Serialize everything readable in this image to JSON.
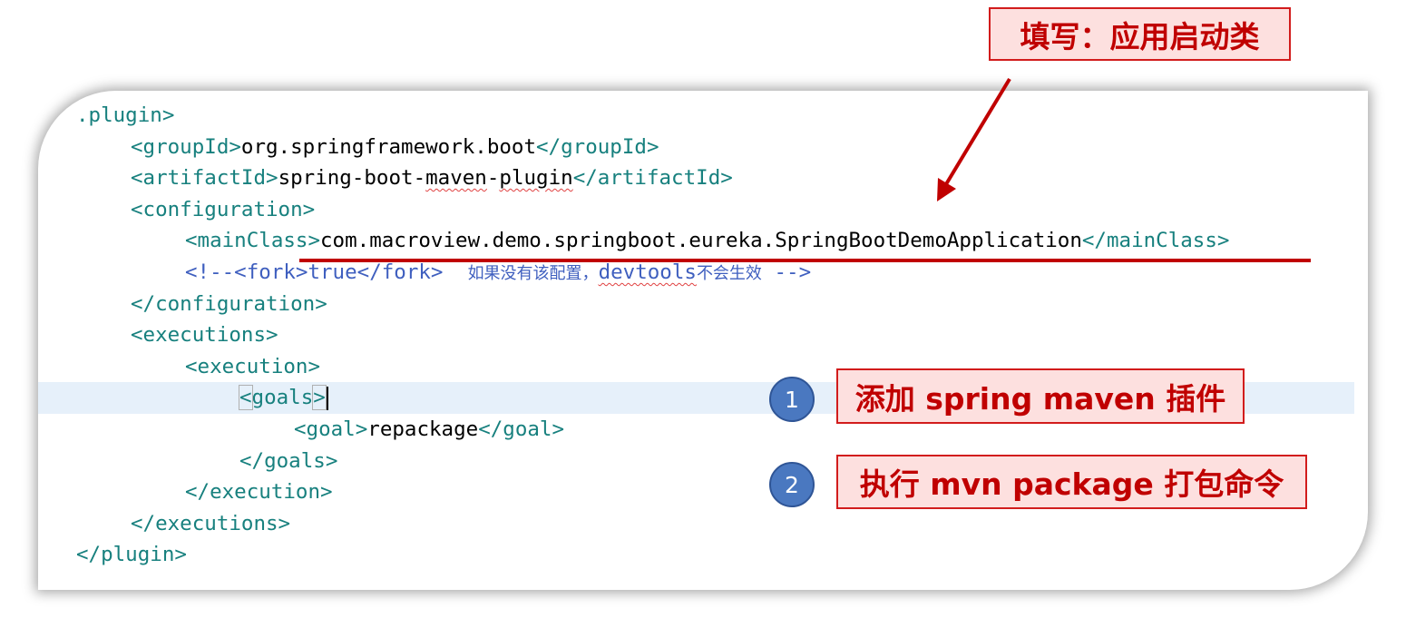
{
  "callouts": {
    "main_class_note": "填写：应用启动类",
    "step1_label": "添加 spring maven 插件",
    "step2_label": "执行 mvn package 打包命令",
    "step1_number": "1",
    "step2_number": "2"
  },
  "code": {
    "l1_tag": ".plugin>",
    "l2_open": "<groupId>",
    "l2_text": "org.springframework.boot",
    "l2_close": "</groupId>",
    "l3_open": "<artifactId>",
    "l3_t1": "spring-boot-",
    "l3_t2": "maven",
    "l3_t3": "-",
    "l3_t4": "plugin",
    "l3_close": "</artifactId>",
    "l4_open": "<configuration>",
    "l5_open": "<mainClass>",
    "l5_text": "com.macroview.demo.springboot.eureka.SpringBootDemoApplication",
    "l5_close": "</mainClass>",
    "l6_c1": "<!--<fork>true</fork>  ",
    "l6_cn1": "如果没有该配置，",
    "l6_c2": "devtools",
    "l6_cn2": "不会生效",
    "l6_c3": " -->",
    "l7_close": "</configuration>",
    "l8_open": "<executions>",
    "l9_open": "<execution>",
    "l10_lt": "<",
    "l10_tag": "goals",
    "l10_gt": ">",
    "l11_open": "<goal>",
    "l11_text": "repackage",
    "l11_close": "</goal>",
    "l12_close": "</goals>",
    "l13_close": "</execution>",
    "l14_close": "</executions>",
    "l15_close": "</plugin>"
  },
  "colors": {
    "tag": "#17807e",
    "comment": "#3f5fbf",
    "callout_text": "#c00000",
    "callout_bg": "#fde0df",
    "badge": "#4a78c0",
    "current_line": "#e6f0fa"
  }
}
